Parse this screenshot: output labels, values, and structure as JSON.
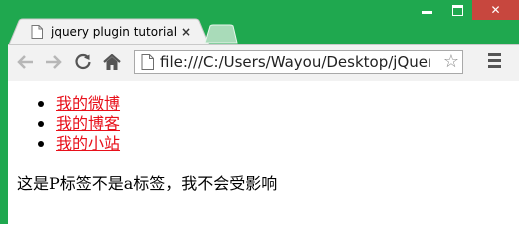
{
  "browser": {
    "tab_title": "jquery plugin tutorial exan",
    "tab_close": "×",
    "address": "file:///C:/Users/Wayou/Desktop/jQuery",
    "star": "☆",
    "window_controls": {
      "close": "✕"
    },
    "colors": {
      "frame": "#1fa84f",
      "close": "#c7473e",
      "link": "#e8101a"
    }
  },
  "page": {
    "links": [
      {
        "label": "我的微博"
      },
      {
        "label": "我的博客"
      },
      {
        "label": "我的小站"
      }
    ],
    "paragraph": "这是P标签不是a标签，我不会受影响"
  }
}
